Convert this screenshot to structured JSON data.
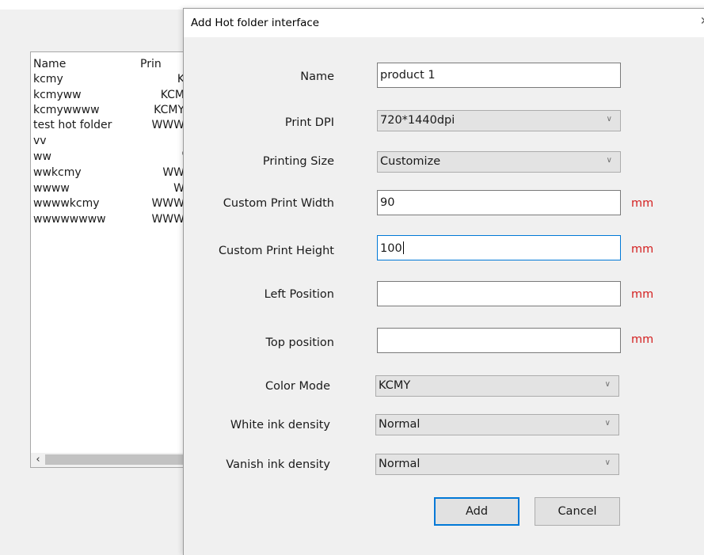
{
  "background": {
    "list": {
      "columns": [
        "Name",
        "Prin"
      ],
      "rows": [
        {
          "name": "kcmy",
          "print": "K"
        },
        {
          "name": "kcmyww",
          "print": "KCM"
        },
        {
          "name": "kcmywwww",
          "print": "KCMY"
        },
        {
          "name": "test hot folder",
          "print": "WWW"
        },
        {
          "name": "vv",
          "print": ""
        },
        {
          "name": "ww",
          "print": "'"
        },
        {
          "name": "wwkcmy",
          "print": "WW"
        },
        {
          "name": "wwww",
          "print": "W"
        },
        {
          "name": "wwwwkcmy",
          "print": "WWW"
        },
        {
          "name": "wwwwwwww",
          "print": "WWW"
        }
      ],
      "scroll_left_icon": "chevron-left-icon"
    }
  },
  "dialog": {
    "title": "Add Hot folder interface",
    "close_icon": "close-icon",
    "fields": {
      "name": {
        "label": "Name",
        "value": "product 1"
      },
      "print_dpi": {
        "label": "Print DPI",
        "value": "720*1440dpi"
      },
      "printing_size": {
        "label": "Printing Size",
        "value": "Customize"
      },
      "custom_width": {
        "label": "Custom Print Width",
        "value": "90",
        "unit": "mm"
      },
      "custom_height": {
        "label": "Custom Print Height",
        "value": "100",
        "unit": "mm"
      },
      "left_position": {
        "label": "Left Position",
        "value": "",
        "unit": "mm"
      },
      "top_position": {
        "label": "Top position",
        "value": "",
        "unit": "mm"
      },
      "color_mode": {
        "label": "Color Mode",
        "value": "KCMY"
      },
      "white_ink": {
        "label": "White ink density",
        "value": "Normal"
      },
      "vanish_ink": {
        "label": "Vanish ink density",
        "value": "Normal"
      }
    },
    "buttons": {
      "add": "Add",
      "cancel": "Cancel"
    },
    "colors": {
      "unit_red": "#d42020",
      "focus_blue": "#0078d7"
    }
  }
}
